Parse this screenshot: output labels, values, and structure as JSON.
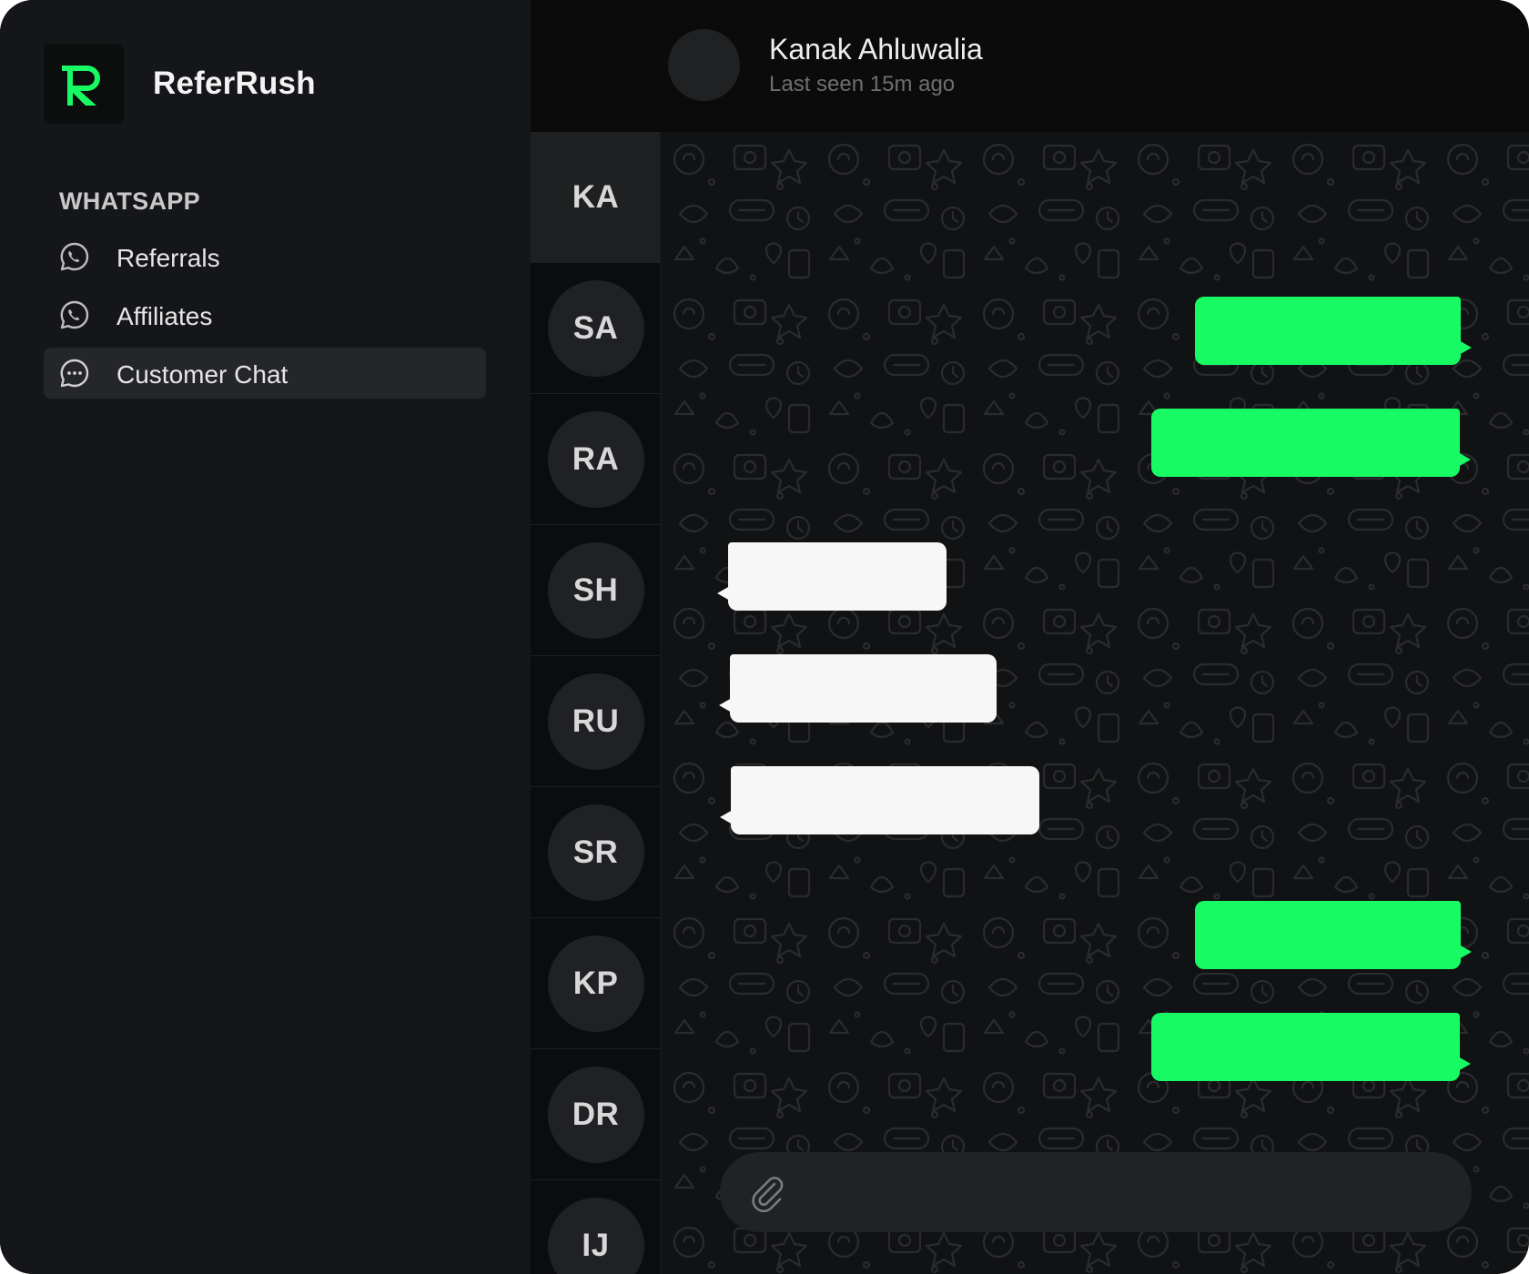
{
  "app": {
    "name": "ReferRush",
    "accent_color": "#17fa64"
  },
  "sidebar": {
    "section_label": "WHATSAPP",
    "items": [
      {
        "label": "Referrals",
        "icon": "whatsapp-icon",
        "active": false
      },
      {
        "label": "Affiliates",
        "icon": "whatsapp-icon",
        "active": false
      },
      {
        "label": "Customer Chat",
        "icon": "chat-bubble-icon",
        "active": true
      }
    ]
  },
  "contacts": [
    {
      "initials": "KA",
      "active": true
    },
    {
      "initials": "SA",
      "active": false
    },
    {
      "initials": "RA",
      "active": false
    },
    {
      "initials": "SH",
      "active": false
    },
    {
      "initials": "RU",
      "active": false
    },
    {
      "initials": "SR",
      "active": false
    },
    {
      "initials": "KP",
      "active": false
    },
    {
      "initials": "DR",
      "active": false
    },
    {
      "initials": "IJ",
      "active": false
    }
  ],
  "chat": {
    "contact_name": "Kanak Ahluwalia",
    "status": "Last seen 15m ago",
    "messages": [
      {
        "direction": "outgoing",
        "text": ""
      },
      {
        "direction": "outgoing",
        "text": ""
      },
      {
        "direction": "incoming",
        "text": ""
      },
      {
        "direction": "incoming",
        "text": ""
      },
      {
        "direction": "incoming",
        "text": ""
      },
      {
        "direction": "outgoing",
        "text": ""
      },
      {
        "direction": "outgoing",
        "text": ""
      }
    ],
    "composer": {
      "placeholder": "",
      "attach_icon": "paperclip-icon"
    }
  }
}
